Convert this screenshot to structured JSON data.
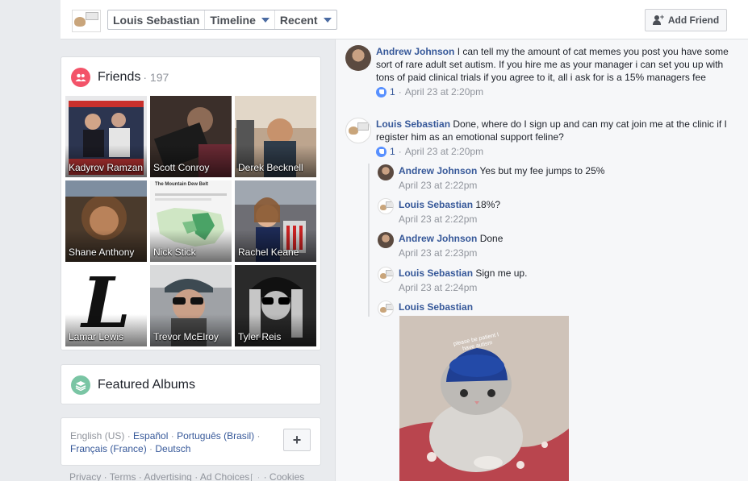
{
  "header": {
    "breadcrumbs": [
      {
        "label": "Louis Sebastian",
        "dropdown": false
      },
      {
        "label": "Timeline",
        "dropdown": true
      },
      {
        "label": "Recent",
        "dropdown": true
      }
    ],
    "add_friend_label": "Add Friend"
  },
  "friends": {
    "title": "Friends",
    "count": "197",
    "items": [
      {
        "name": "Kadyrov Ramzan"
      },
      {
        "name": "Scott Conroy"
      },
      {
        "name": "Derek Becknell"
      },
      {
        "name": "Shane Anthony"
      },
      {
        "name": "Nick Stick"
      },
      {
        "name": "Rachel Keane"
      },
      {
        "name": "Lamar Lewis"
      },
      {
        "name": "Trevor McElroy"
      },
      {
        "name": "Tyler Reis"
      }
    ],
    "tile_overlay_texts": {
      "nick_map_title": "The Mountain Dew Belt",
      "lamar_letter": "L"
    }
  },
  "albums": {
    "title": "Featured Albums"
  },
  "languages": {
    "current": "English (US)",
    "links": [
      "Español",
      "Português (Brasil)",
      "Français (France)",
      "Deutsch"
    ],
    "more_label": "+"
  },
  "footer": {
    "links": [
      "Privacy",
      "Terms",
      "Advertising",
      "Ad Choices",
      "Cookies"
    ]
  },
  "comments": [
    {
      "author": "Andrew Johnson",
      "text": "I can tell my the amount of cat memes you post you have some sort of rare adult set autism. If you hire me as your manager i can set you up with tons of paid clinical trials if you agree to it, all i ask for is a 15% managers fee",
      "likes": "1",
      "time": "April 23 at 2:20pm"
    },
    {
      "author": "Louis Sebastian",
      "text": "Done, where do I sign up and can my cat join me at the clinic if I register him as an emotional support feline?",
      "likes": "1",
      "time": "April 23 at 2:20pm"
    }
  ],
  "replies": [
    {
      "author": "Andrew Johnson",
      "text": "Yes but my fee jumps to 25%",
      "time": "April 23 at 2:22pm"
    },
    {
      "author": "Louis Sebastian",
      "text": "18%?",
      "time": "April 23 at 2:22pm"
    },
    {
      "author": "Andrew Johnson",
      "text": "Done",
      "time": "April 23 at 2:23pm"
    },
    {
      "author": "Louis Sebastian",
      "text": "Sign me up.",
      "time": "April 23 at 2:24pm"
    },
    {
      "author": "Louis Sebastian",
      "text": "",
      "time": ""
    }
  ],
  "photo": {
    "hat_text": "please be patient I have autism"
  },
  "colors": {
    "link": "#365899",
    "friends_icon": "#f35369",
    "albums_icon": "#7ac5a4",
    "like_blue": "#5890ff"
  }
}
